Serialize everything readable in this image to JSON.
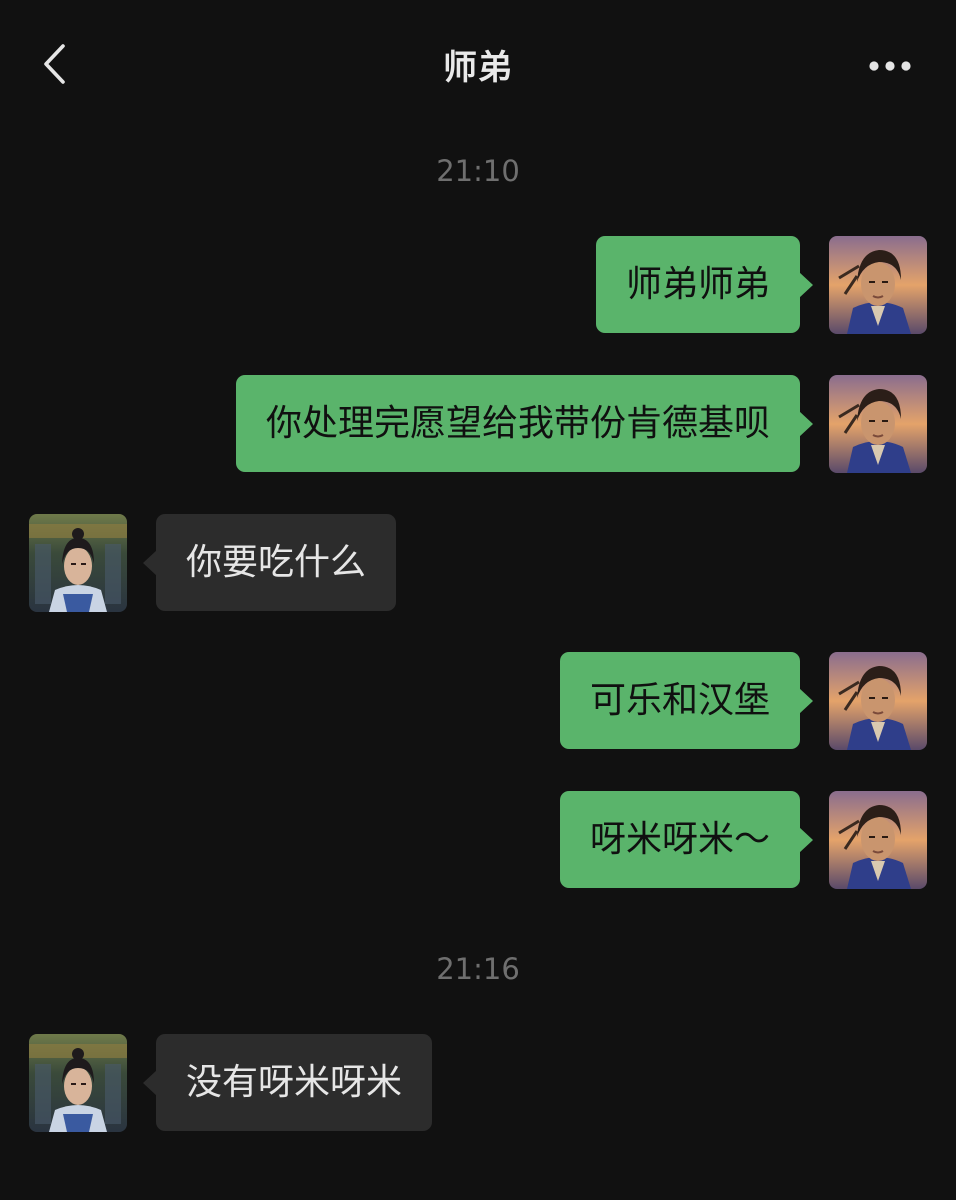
{
  "header": {
    "title": "师弟",
    "back_icon": "chevron-left-icon",
    "more_icon": "more-dots-icon"
  },
  "colors": {
    "background": "#111111",
    "my_bubble": "#5ab46b",
    "their_bubble": "#2c2c2c",
    "timestamp": "#6f6f6f"
  },
  "timestamps": [
    "21:10",
    "21:16"
  ],
  "messages": [
    {
      "from": "me",
      "text": "师弟师弟"
    },
    {
      "from": "me",
      "text": "你处理完愿望给我带份肯德基呗"
    },
    {
      "from": "them",
      "text": "你要吃什么"
    },
    {
      "from": "me",
      "text": "可乐和汉堡"
    },
    {
      "from": "me",
      "text": "呀米呀米～"
    },
    {
      "from": "them",
      "text": "没有呀米呀米"
    }
  ]
}
